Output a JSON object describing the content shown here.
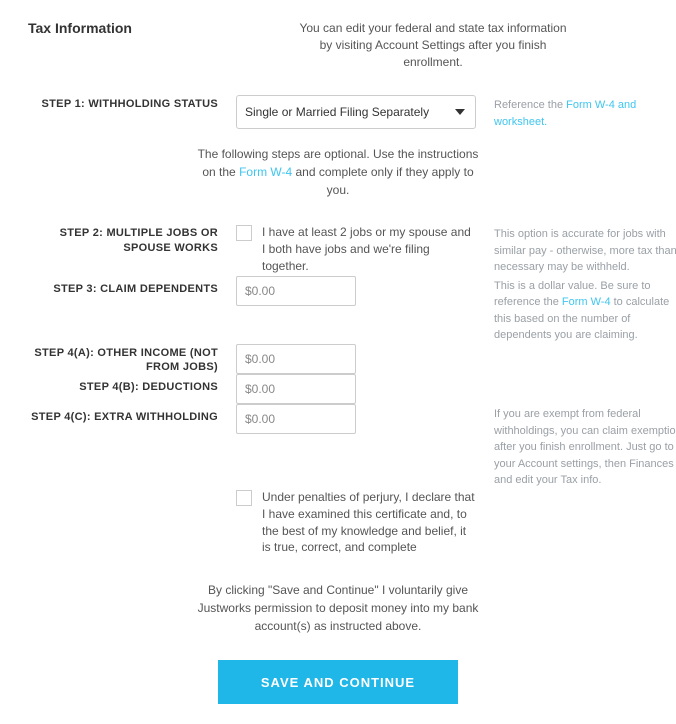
{
  "section_title": "Tax Information",
  "intro_text": "You can edit your federal and state tax information by visiting Account Settings after you finish enrollment.",
  "step1": {
    "label": "STEP 1: WITHHOLDING STATUS",
    "selected": "Single or Married Filing Separately",
    "help_prefix": "Reference the ",
    "help_link": "Form W-4 and worksheet."
  },
  "optional_note": {
    "prefix": "The following steps are optional. Use the instructions on the ",
    "link": "Form W-4",
    "suffix": " and complete only if they apply to you."
  },
  "step2": {
    "label": "STEP 2: MULTIPLE JOBS OR SPOUSE WORKS",
    "checkbox_label": "I have at least 2 jobs or my spouse and I both have jobs and we're filing together.",
    "help_text": "This option is accurate for jobs with similar pay - otherwise, more tax than necessary may be withheld."
  },
  "step3": {
    "label": "STEP 3: CLAIM DEPENDENTS",
    "value": "$0.00",
    "help_prefix": "This is a dollar value. Be sure to reference the ",
    "help_link": "Form W-4",
    "help_suffix": " to calculate this based on the number of dependents you are claiming."
  },
  "step4a": {
    "label": "STEP 4(A): OTHER INCOME (NOT FROM JOBS)",
    "value": "$0.00"
  },
  "step4b": {
    "label": "STEP 4(B): DEDUCTIONS",
    "value": "$0.00"
  },
  "step4c": {
    "label": "STEP 4(C): EXTRA WITHHOLDING",
    "value": "$0.00",
    "help_text": "If you are exempt from federal withholdings, you can claim exemption after you finish enrollment. Just go to your Account settings, then Finances and edit your Tax info."
  },
  "perjury": {
    "label": "Under penalties of perjury, I declare that I have examined this certificate and, to the best of my knowledge and belief, it is true, correct, and complete"
  },
  "disclosure": "By clicking \"Save and Continue\" I voluntarily give Justworks permission to deposit money into my bank account(s) as instructed above.",
  "save_button": "SAVE AND CONTINUE"
}
